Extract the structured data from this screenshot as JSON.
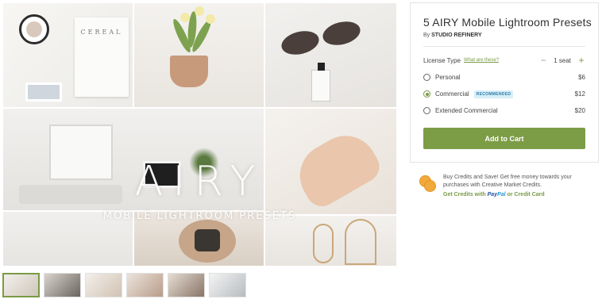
{
  "gallery": {
    "overlay_title": "AIRY",
    "overlay_subtitle": "MOBILE LIGHTROOM PRESETS",
    "book_title": "CEREAL",
    "thumbnail_count": 6
  },
  "product": {
    "title": "5 AIRY Mobile Lightroom Presets",
    "by_prefix": "By",
    "seller": "STUDIO REFINERY"
  },
  "license": {
    "label": "License Type",
    "help_link": "What are these?",
    "seat_text": "1 seat",
    "minus": "−",
    "plus": "+",
    "options": [
      {
        "label": "Personal",
        "price": "$6",
        "selected": false
      },
      {
        "label": "Commercial",
        "badge": "RECOMMENDED",
        "price": "$12",
        "selected": true
      },
      {
        "label": "Extended Commercial",
        "price": "$20",
        "selected": false
      }
    ]
  },
  "cart": {
    "button_label": "Add to Cart"
  },
  "credits": {
    "line1": "Buy Credits and Save! Get free money towards your purchases with Creative Market Credits.",
    "link_prefix": "Get Credits with",
    "paypal_a": "Pay",
    "paypal_b": "Pal",
    "link_suffix": "or Credit Card"
  },
  "colors": {
    "accent": "#7c9c46",
    "badge_bg": "#d8eef8",
    "coin": "#f2a93b"
  }
}
